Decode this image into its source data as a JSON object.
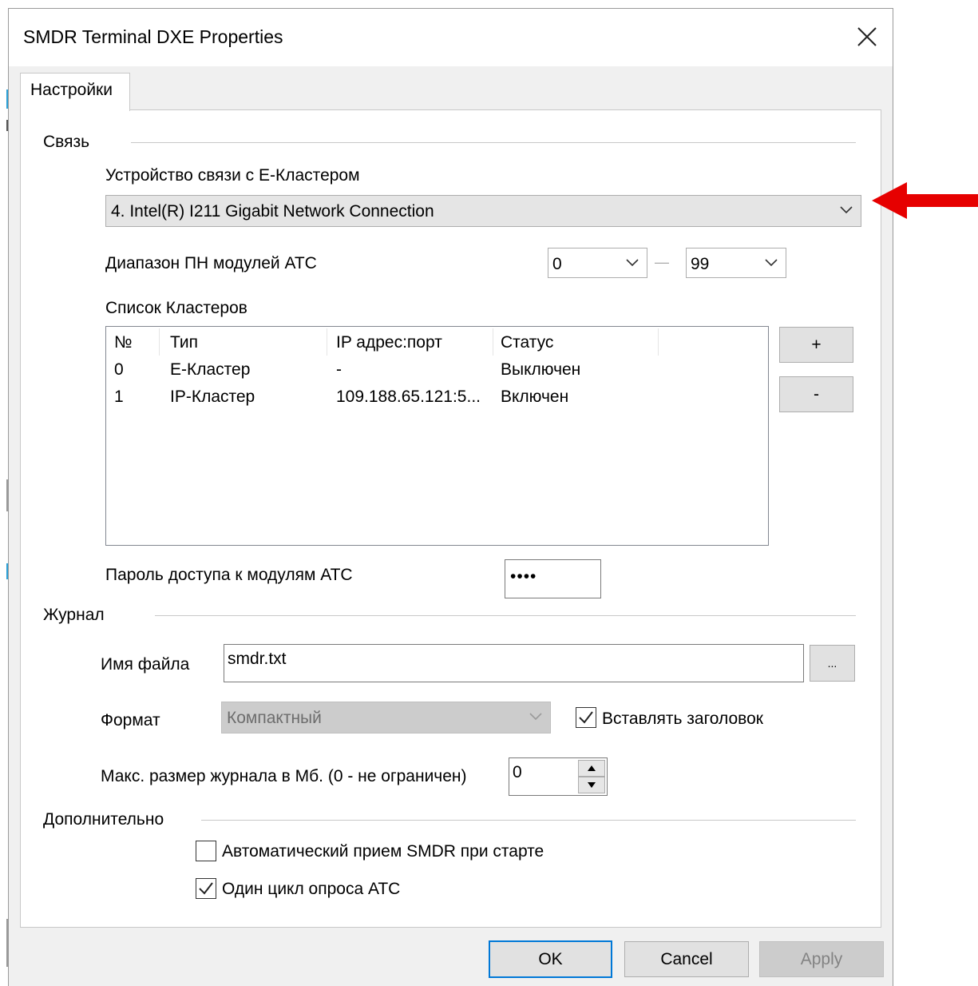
{
  "window": {
    "title": "SMDR Terminal DXE Properties",
    "close_icon": "close-icon"
  },
  "tabs": [
    {
      "label": "Настройки",
      "active": true
    }
  ],
  "sections": {
    "connection": {
      "title": "Связь",
      "device_label": "Устройство связи с E-Кластером",
      "device_value": "4. Intel(R) I211 Gigabit Network Connection",
      "range_label": "Диапазон ПН модулей АТС",
      "range_from": "0",
      "range_to": "99",
      "range_dash": "—",
      "clusters_label": "Список Кластеров",
      "clusters_columns": [
        "№",
        "Тип",
        "IP адрес:порт",
        "Статус"
      ],
      "clusters_rows": [
        [
          "0",
          "E-Кластер",
          "-",
          "Выключен"
        ],
        [
          "1",
          "IP-Кластер",
          "109.188.65.121:5...",
          "Включен"
        ]
      ],
      "add_button": "+",
      "remove_button": "-",
      "password_label": "Пароль доступа к модулям АТС",
      "password_value": "••••"
    },
    "log": {
      "title": "Журнал",
      "filename_label": "Имя файла",
      "filename_value": "smdr.txt",
      "browse_button": "...",
      "format_label": "Формат",
      "format_value": "Компактный",
      "insert_header_label": "Вставлять заголовок",
      "insert_header_checked": true,
      "max_size_label": "Макс. размер журнала в Мб. (0 - не ограничен)",
      "max_size_value": "0"
    },
    "extra": {
      "title": "Дополнительно",
      "auto_receive_label": "Автоматический прием SMDR при старте",
      "auto_receive_checked": false,
      "one_cycle_label": "Один цикл опроса АТС",
      "one_cycle_checked": true
    }
  },
  "buttons": {
    "ok": "OK",
    "cancel": "Cancel",
    "apply": "Apply"
  },
  "colors": {
    "accent": "#0078d7",
    "annotation_arrow": "#e60000"
  }
}
